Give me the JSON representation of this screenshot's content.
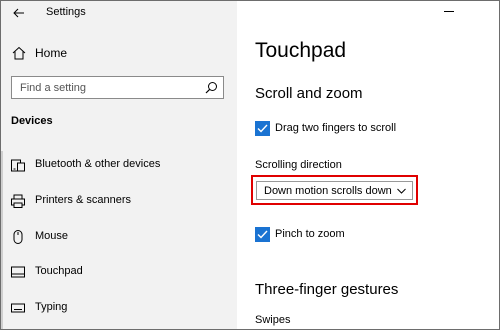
{
  "window": {
    "title": "Settings"
  },
  "nav": {
    "home_label": "Home",
    "search_placeholder": "Find a setting",
    "section_label": "Devices",
    "items": [
      {
        "label": "Bluetooth & other devices",
        "icon": "bluetooth-devices-icon"
      },
      {
        "label": "Printers & scanners",
        "icon": "printer-icon"
      },
      {
        "label": "Mouse",
        "icon": "mouse-icon"
      },
      {
        "label": "Touchpad",
        "icon": "touchpad-icon"
      },
      {
        "label": "Typing",
        "icon": "keyboard-icon"
      }
    ]
  },
  "content": {
    "page_title": "Touchpad",
    "scroll_zoom": {
      "title": "Scroll and zoom",
      "drag_two_fingers": {
        "label": "Drag two fingers to scroll",
        "checked": true
      },
      "scrolling_direction_label": "Scrolling direction",
      "scrolling_direction_value": "Down motion scrolls down",
      "pinch_to_zoom": {
        "label": "Pinch to zoom",
        "checked": true
      }
    },
    "three_finger": {
      "title": "Three-finger gestures",
      "swipes_label": "Swipes"
    }
  },
  "colors": {
    "accent": "#1a73d2",
    "highlight_border": "#e00000",
    "nav_bg": "#f2f2f2"
  }
}
